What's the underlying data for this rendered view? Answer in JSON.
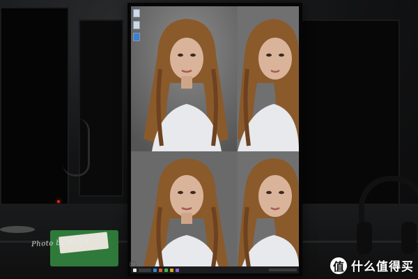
{
  "scene": {
    "description_kind": "photo",
    "colors": {
      "room": "#121314",
      "screen_gray": "#6d6d6d",
      "hair": "#8a5a2b",
      "skin": "#d9b49a",
      "shirt": "#e7e9ec",
      "taskbar": "#1c1c1e",
      "accent_green": "#2f7a3a",
      "power_led": "#e02a1d"
    }
  },
  "monitor": {
    "desktop_icons": [
      "file-icon",
      "file-icon",
      "app-icon"
    ],
    "photos": [
      {
        "name": "portrait-full"
      },
      {
        "name": "portrait-half"
      },
      {
        "name": "portrait-full"
      },
      {
        "name": "portrait-half"
      }
    ],
    "taskbar": {
      "apps": [
        "#2e8bd6",
        "#e05a2b",
        "#3fb950",
        "#d9a520",
        "#8a63d2"
      ]
    }
  },
  "watermark": {
    "signature_text": "Photo by Wei S.",
    "brand_badge": "值",
    "brand_text": "什么值得买"
  }
}
